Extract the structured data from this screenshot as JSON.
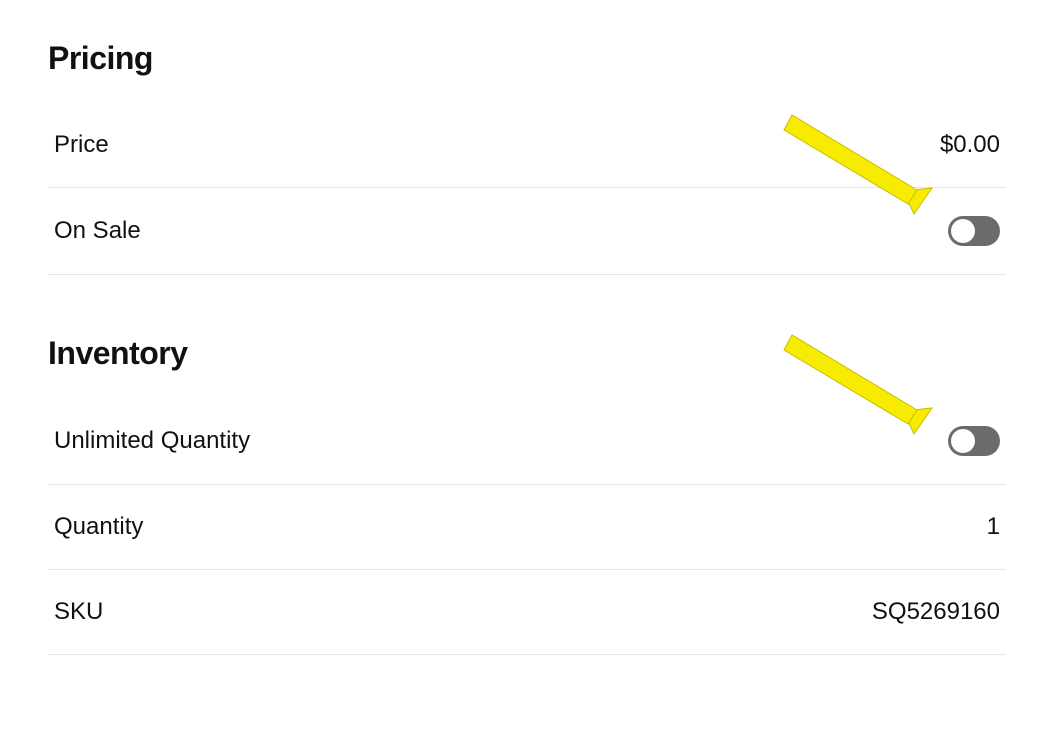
{
  "pricing": {
    "title": "Pricing",
    "price_label": "Price",
    "price_value": "$0.00",
    "on_sale_label": "On Sale"
  },
  "inventory": {
    "title": "Inventory",
    "unlimited_label": "Unlimited Quantity",
    "quantity_label": "Quantity",
    "quantity_value": "1",
    "sku_label": "SKU",
    "sku_value": "SQ5269160"
  },
  "annotation": {
    "arrow_color": "#f7ec00"
  }
}
